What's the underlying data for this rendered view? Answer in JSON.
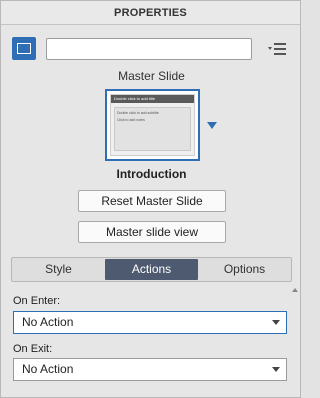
{
  "panel": {
    "title": "PROPERTIES"
  },
  "top_row": {
    "slide_icon": "slide-icon",
    "name_value": "",
    "name_placeholder": "",
    "menu_icon": "list-menu-icon"
  },
  "master": {
    "label": "Master Slide",
    "thumbnail_title": "Double click to add title",
    "thumbnail_lines": [
      "Double click to add subtitle",
      "Click to add notes"
    ],
    "selected_name": "Introduction",
    "reset_button": "Reset Master Slide",
    "view_button": "Master slide view"
  },
  "tabs": [
    {
      "label": "Style",
      "active": false
    },
    {
      "label": "Actions",
      "active": true
    },
    {
      "label": "Options",
      "active": false
    }
  ],
  "actions": {
    "on_enter_label": "On Enter:",
    "on_enter_value": "No Action",
    "on_exit_label": "On Exit:",
    "on_exit_value": "No Action"
  },
  "colors": {
    "accent": "#2f6db5",
    "active_tab": "#4d5a6f",
    "panel_bg": "#e6e6e6"
  }
}
